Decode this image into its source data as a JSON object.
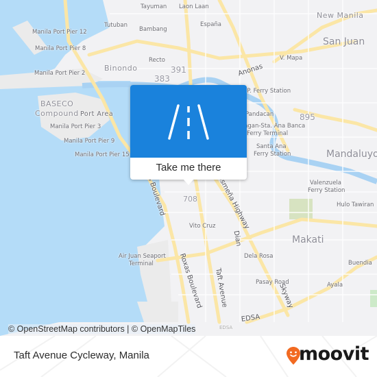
{
  "map": {
    "labels": {
      "tayuman": "Tayuman",
      "laon_laan": "Laon Laan",
      "espana": "España",
      "new_manila": "New Manila",
      "san_juan": "San Juan",
      "tutuban": "Tutuban",
      "bambang": "Bambang",
      "pier12": "Manila Port Pier 12",
      "pier8": "Manila Port Pier 8",
      "pier2": "Manila Port Pier 2",
      "binondo": "Binondo",
      "recto": "Recto",
      "r391": "391",
      "r383": "383",
      "vmapa": "V. Mapa",
      "anonas": "Anonas",
      "pup_ferry": "P.U.P. Ferry Station",
      "baseco1": "BASECO",
      "baseco2": "Compound",
      "port_area": "Port Area",
      "pier3": "Manila Port Pier 3",
      "pier9": "Manila Port Pier 9",
      "pier15": "Manila Port Pier 15",
      "pandacan": "Pandacan",
      "r895": "895",
      "lambingan1": "Lambingan-Sta. Ana Banca",
      "lambingan2": "Ferry Terminal",
      "santa_ana1": "Santa Ana",
      "santa_ana2": "Ferry Station",
      "mandaluyong": "Mandaluyong",
      "roxas_blvd_n": "Roxas Boulevard",
      "osmena": "Osmeña Highway",
      "r708": "708",
      "valenzuela1": "Valenzuela",
      "valenzuela2": "Ferry Station",
      "hulo": "Hulo Tawiran",
      "vito_cruz": "Vito Cruz",
      "dian": "Dian",
      "makati": "Makati",
      "air_juan1": "Air Juan Seaport",
      "air_juan2": "Terminal",
      "dela_rosa": "Dela Rosa",
      "buendia": "Buendia",
      "roxas_blvd_s": "Roxas Boulevard",
      "taft": "Taft Avenue",
      "pasay_road": "Pasay Road",
      "ayala": "Ayala",
      "skyway": "Skyway",
      "edsa": "EDSA",
      "edsa_small": "EDSA"
    },
    "attribution": "© OpenStreetMap contributors | © OpenMapTiles"
  },
  "popup": {
    "icon": "road-icon",
    "button_label": "Take me there",
    "color": "#1a82dc"
  },
  "footer": {
    "title": "Taft Avenue Cycleway, Manila",
    "logo_text": "moovit",
    "logo_color": "#f26a21"
  }
}
